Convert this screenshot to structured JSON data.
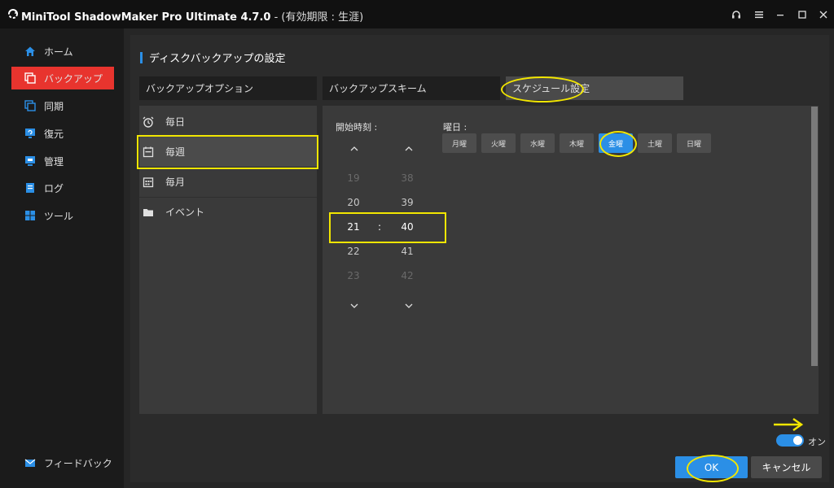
{
  "titlebar": {
    "app_name": "MiniTool ShadowMaker Pro Ultimate 4.7.0",
    "license": " - (有効期限 : 生涯)"
  },
  "sidebar": {
    "items": [
      {
        "label": "ホーム",
        "icon": "home-icon"
      },
      {
        "label": "バックアップ",
        "icon": "backup-icon"
      },
      {
        "label": "同期",
        "icon": "sync-icon"
      },
      {
        "label": "復元",
        "icon": "restore-icon"
      },
      {
        "label": "管理",
        "icon": "manage-icon"
      },
      {
        "label": "ログ",
        "icon": "log-icon"
      },
      {
        "label": "ツール",
        "icon": "tools-icon"
      }
    ],
    "feedback": "フィードバック"
  },
  "page_title": "ディスクバックアップの設定",
  "tabs": [
    {
      "label": "バックアップオプション"
    },
    {
      "label": "バックアップスキーム"
    },
    {
      "label": "スケジュール設定"
    }
  ],
  "schedule_types": [
    {
      "label": "毎日",
      "icon": "alarm-clock-icon"
    },
    {
      "label": "毎週",
      "icon": "calendar-week-icon"
    },
    {
      "label": "毎月",
      "icon": "calendar-month-icon"
    },
    {
      "label": "イベント",
      "icon": "folder-icon"
    }
  ],
  "time_picker": {
    "label": "開始時刻 :",
    "hours": [
      "19",
      "20",
      "21",
      "22",
      "23"
    ],
    "minutes": [
      "38",
      "39",
      "40",
      "41",
      "42"
    ],
    "separator": ":"
  },
  "weekdays": {
    "label": "曜日 :",
    "days": [
      "月曜",
      "火曜",
      "水曜",
      "木曜",
      "金曜",
      "土曜",
      "日曜"
    ],
    "selected": "金曜"
  },
  "toggle": {
    "label": "オン",
    "on": true
  },
  "buttons": {
    "ok": "OK",
    "cancel": "キャンセル"
  },
  "colors": {
    "accent": "#2b8fe6",
    "active_nav": "#e8342e",
    "highlight": "#f2e600"
  }
}
